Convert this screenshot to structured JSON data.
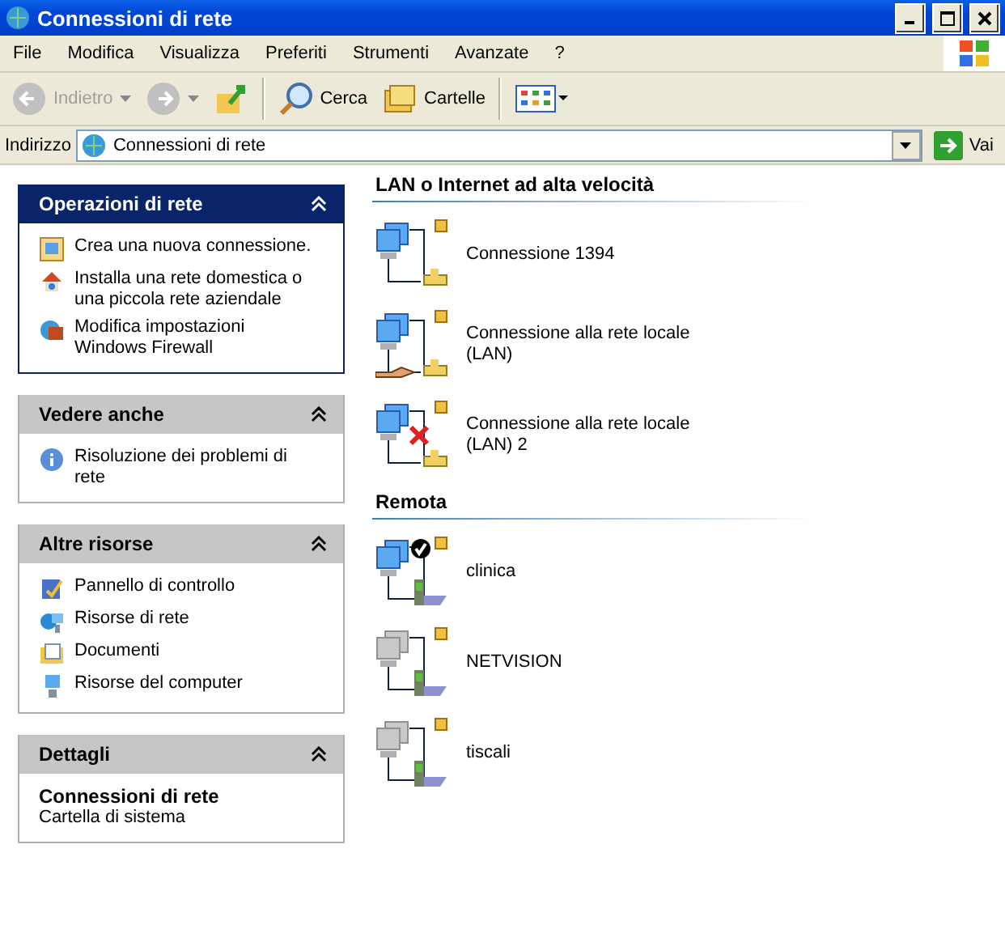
{
  "window": {
    "title": "Connessioni di rete"
  },
  "menu": [
    "File",
    "Modifica",
    "Visualizza",
    "Preferiti",
    "Strumenti",
    "Avanzate",
    "?"
  ],
  "toolbar": {
    "back": {
      "label": "Indietro",
      "disabled": true
    },
    "forward": {
      "disabled": true
    },
    "search": "Cerca",
    "folders": "Cartelle"
  },
  "address": {
    "label": "Indirizzo",
    "value": "Connessioni di rete",
    "go": "Vai"
  },
  "task_panels": [
    {
      "title": "Operazioni di rete",
      "primary": true,
      "kind": "links",
      "items": [
        {
          "label": "Crea una nuova connessione."
        },
        {
          "label": "Installa una rete domestica o una piccola rete aziendale"
        },
        {
          "label": "Modifica impostazioni Windows Firewall"
        }
      ]
    },
    {
      "title": "Vedere anche",
      "primary": false,
      "kind": "links",
      "items": [
        {
          "label": "Risoluzione dei problemi di rete"
        }
      ]
    },
    {
      "title": "Altre risorse",
      "primary": false,
      "kind": "links",
      "items": [
        {
          "label": "Pannello di controllo"
        },
        {
          "label": "Risorse di rete"
        },
        {
          "label": "Documenti"
        },
        {
          "label": "Risorse del computer"
        }
      ]
    },
    {
      "title": "Dettagli",
      "primary": false,
      "kind": "details",
      "name": "Connessioni di rete",
      "description": "Cartella di sistema"
    }
  ],
  "groups": [
    {
      "title": "LAN o Internet ad alta velocità",
      "items": [
        {
          "name": "Connessione 1394",
          "kind": "lan",
          "connected": true,
          "shared": false,
          "default": false
        },
        {
          "name": "Connessione alla rete locale (LAN)",
          "kind": "lan",
          "connected": true,
          "shared": true,
          "default": false
        },
        {
          "name": "Connessione alla rete locale (LAN) 2",
          "kind": "lan",
          "connected": false,
          "shared": false,
          "default": false
        }
      ]
    },
    {
      "title": "Remota",
      "items": [
        {
          "name": "clinica",
          "kind": "dialup",
          "connected": true,
          "shared": false,
          "default": true
        },
        {
          "name": "NETVISION",
          "kind": "dialup",
          "connected": false,
          "shared": false,
          "default": false
        },
        {
          "name": "tiscali",
          "kind": "dialup",
          "connected": false,
          "shared": false,
          "default": false
        }
      ]
    }
  ]
}
